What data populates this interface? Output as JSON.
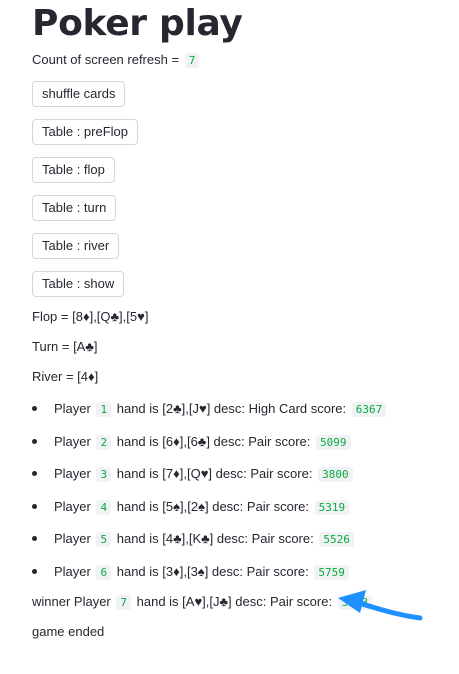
{
  "page": {
    "title": "Poker play"
  },
  "refresh": {
    "label": "Count of screen refresh =",
    "count": "7"
  },
  "buttons": {
    "shuffle": "shuffle cards",
    "preflop": "Table : preFlop",
    "flop": "Table : flop",
    "turn": "Table : turn",
    "river": "Table : river",
    "show": "Table : show"
  },
  "board": {
    "flop": "Flop = [8♦],[Q♣],[5♥]",
    "turn": "Turn = [A♣]",
    "river": "River = [4♦]"
  },
  "players": [
    {
      "prefix": "Player",
      "num": "1",
      "hand": "hand is [2♣],[J♥] desc: High Card score:",
      "score": "6367"
    },
    {
      "prefix": "Player",
      "num": "2",
      "hand": "hand is [6♦],[6♣] desc: Pair score:",
      "score": "5099"
    },
    {
      "prefix": "Player",
      "num": "3",
      "hand": "hand is [7♦],[Q♥] desc: Pair score:",
      "score": "3800"
    },
    {
      "prefix": "Player",
      "num": "4",
      "hand": "hand is [5♠],[2♠] desc: Pair score:",
      "score": "5319"
    },
    {
      "prefix": "Player",
      "num": "5",
      "hand": "hand is [4♣],[K♣] desc: Pair score:",
      "score": "5526"
    },
    {
      "prefix": "Player",
      "num": "6",
      "hand": "hand is [3♦],[3♠] desc: Pair score:",
      "score": "5759"
    }
  ],
  "winner": {
    "prefix": "winner Player",
    "num": "7",
    "hand": "hand is [A♥],[J♣] desc: Pair score:",
    "score": "3383"
  },
  "status": {
    "text": "game ended"
  },
  "colors": {
    "code_text": "#09ab3b",
    "code_bg": "#f0f2f6",
    "arrow": "#1e90ff",
    "text": "#262730"
  },
  "annotation": {
    "arrow_icon": "arrow-pointer-icon"
  }
}
